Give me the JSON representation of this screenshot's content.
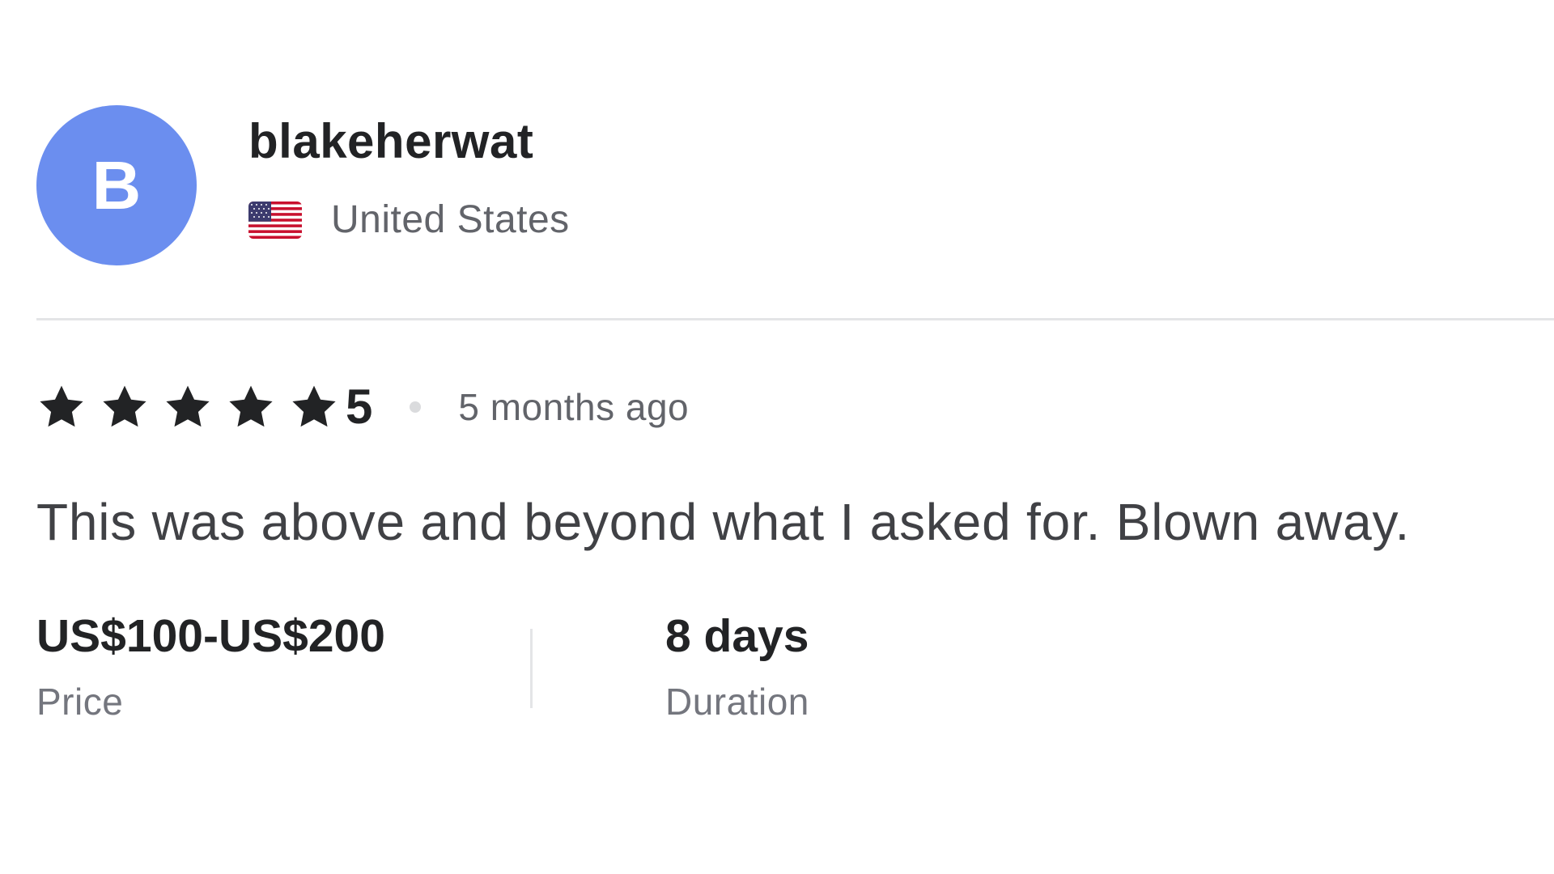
{
  "reviewer": {
    "initial": "B",
    "avatar_color": "#6b8eef",
    "username": "blakeherwat",
    "country": "United States",
    "flag_icon": "us-flag-icon"
  },
  "review": {
    "stars": 5,
    "rating": "5",
    "time_ago": "5 months ago",
    "text": "This was above and beyond what I asked for. Blown away."
  },
  "details": {
    "price_value": "US$100-US$200",
    "price_label": "Price",
    "duration_value": "8 days",
    "duration_label": "Duration"
  },
  "colors": {
    "star": "#222325",
    "divider": "#e4e5e7"
  }
}
